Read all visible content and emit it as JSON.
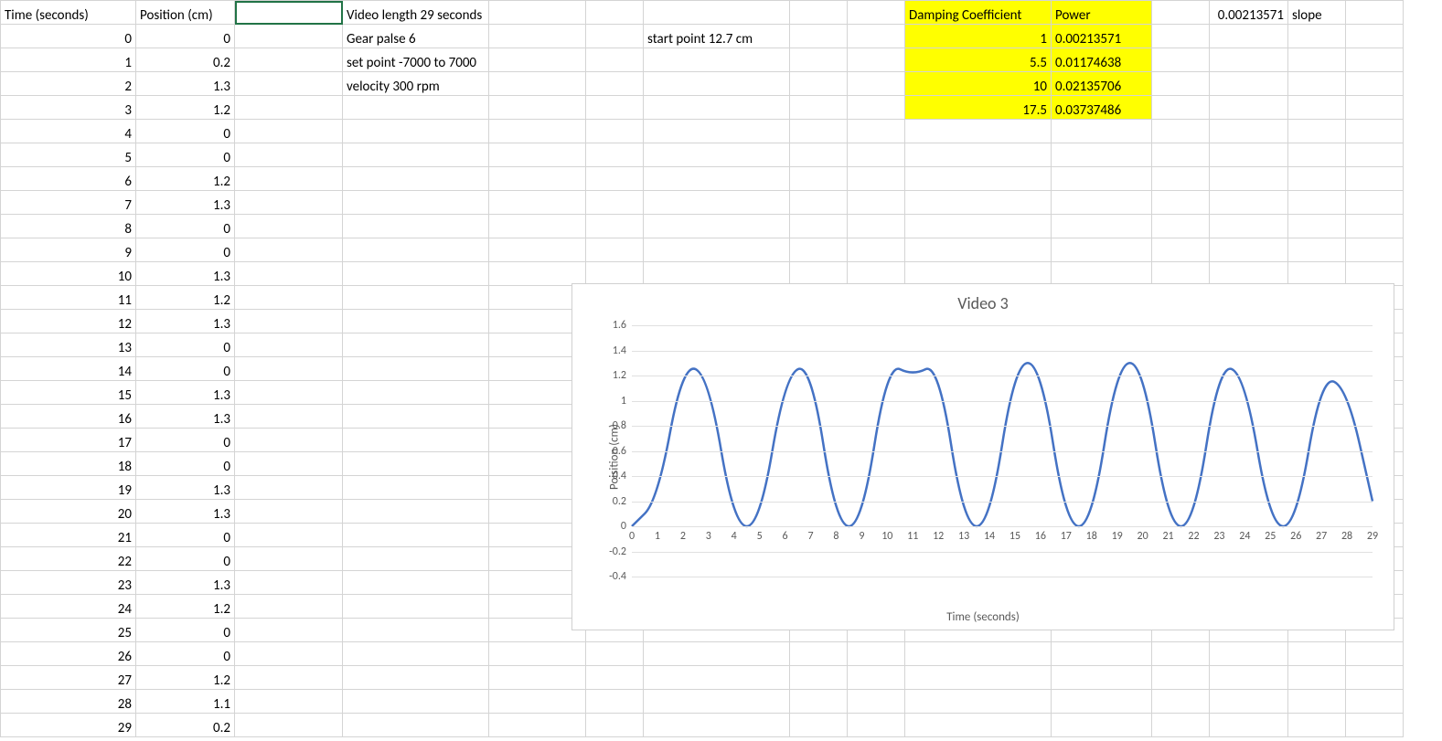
{
  "headers": {
    "time": "Time (seconds)",
    "position": "Position (cm)"
  },
  "time_position": [
    [
      0,
      0
    ],
    [
      1,
      0.2
    ],
    [
      2,
      1.3
    ],
    [
      3,
      1.2
    ],
    [
      4,
      0
    ],
    [
      5,
      0
    ],
    [
      6,
      1.2
    ],
    [
      7,
      1.3
    ],
    [
      8,
      0
    ],
    [
      9,
      0
    ],
    [
      10,
      1.3
    ],
    [
      11,
      1.2
    ],
    [
      12,
      1.3
    ],
    [
      13,
      0
    ],
    [
      14,
      0
    ],
    [
      15,
      1.3
    ],
    [
      16,
      1.3
    ],
    [
      17,
      0
    ],
    [
      18,
      0
    ],
    [
      19,
      1.3
    ],
    [
      20,
      1.3
    ],
    [
      21,
      0
    ],
    [
      22,
      0
    ],
    [
      23,
      1.3
    ],
    [
      24,
      1.2
    ],
    [
      25,
      0
    ],
    [
      26,
      0
    ],
    [
      27,
      1.2
    ],
    [
      28,
      1.1
    ],
    [
      29,
      0.2
    ]
  ],
  "notes": {
    "videoLength": "Video length 29 seconds",
    "gearPalse": "Gear palse 6",
    "setPoint": "set point -7000 to 7000",
    "velocity": "velocity 300 rpm",
    "startPoint": "start point 12.7 cm"
  },
  "damping": {
    "header_coeff": "Damping Coefficient",
    "header_power": "Power",
    "rows": [
      {
        "coeff": "1",
        "power": "0.00213571"
      },
      {
        "coeff": "5.5",
        "power": "0.01174638"
      },
      {
        "coeff": "10",
        "power": "0.02135706"
      },
      {
        "coeff": "17.5",
        "power": "0.03737486"
      }
    ]
  },
  "slope": {
    "value": "0.00213571",
    "label": "slope"
  },
  "chart_data": {
    "type": "line",
    "title": "Video 3",
    "xlabel": "Time (seconds)",
    "ylabel": "Poisition (cm)",
    "ylim": [
      -0.4,
      1.6
    ],
    "yticks": [
      -0.4,
      -0.2,
      0,
      0.2,
      0.4,
      0.6,
      0.8,
      1,
      1.2,
      1.4,
      1.6
    ],
    "xlim": [
      0,
      29
    ],
    "xticks": [
      0,
      1,
      2,
      3,
      4,
      5,
      6,
      7,
      8,
      9,
      10,
      11,
      12,
      13,
      14,
      15,
      16,
      17,
      18,
      19,
      20,
      21,
      22,
      23,
      24,
      25,
      26,
      27,
      28,
      29
    ],
    "x": [
      0,
      1,
      2,
      3,
      4,
      5,
      6,
      7,
      8,
      9,
      10,
      11,
      12,
      13,
      14,
      15,
      16,
      17,
      18,
      19,
      20,
      21,
      22,
      23,
      24,
      25,
      26,
      27,
      28,
      29
    ],
    "y": [
      0,
      0.2,
      1.3,
      1.2,
      0,
      0,
      1.2,
      1.3,
      0,
      0,
      1.3,
      1.2,
      1.3,
      0,
      0,
      1.3,
      1.3,
      0,
      0,
      1.3,
      1.3,
      0,
      0,
      1.3,
      1.2,
      0,
      0,
      1.2,
      1.1,
      0.2
    ]
  }
}
